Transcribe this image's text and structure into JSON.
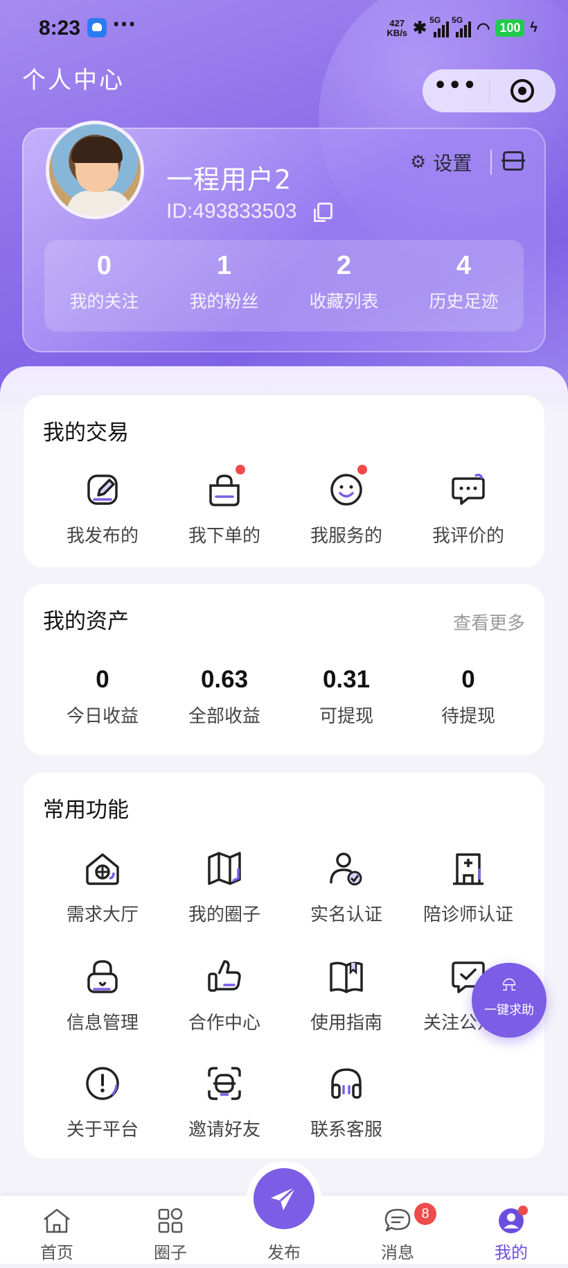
{
  "status_bar": {
    "time": "8:23",
    "dots": "···",
    "net_speed_value": "427",
    "net_speed_unit": "KB/s",
    "sim1": "5G",
    "sim2": "5G",
    "battery": "100"
  },
  "header": {
    "title": "个人中心",
    "capsule_more": "•••"
  },
  "profile": {
    "username": "一程用户2",
    "user_id": "ID:493833503",
    "settings_label": "设置",
    "stats": [
      {
        "value": "0",
        "label": "我的关注"
      },
      {
        "value": "1",
        "label": "我的粉丝"
      },
      {
        "value": "2",
        "label": "收藏列表"
      },
      {
        "value": "4",
        "label": "历史足迹"
      }
    ]
  },
  "transactions": {
    "title": "我的交易",
    "items": [
      {
        "label": "我发布的",
        "icon": "edit-icon",
        "dot": false
      },
      {
        "label": "我下单的",
        "icon": "shopping-bag-icon",
        "dot": true
      },
      {
        "label": "我服务的",
        "icon": "smile-icon",
        "dot": true
      },
      {
        "label": "我评价的",
        "icon": "comment-icon",
        "dot": false
      }
    ]
  },
  "assets": {
    "title": "我的资产",
    "more": "查看更多",
    "items": [
      {
        "value": "0",
        "label": "今日收益"
      },
      {
        "value": "0.63",
        "label": "全部收益"
      },
      {
        "value": "0.31",
        "label": "可提现"
      },
      {
        "value": "0",
        "label": "待提现"
      }
    ]
  },
  "functions": {
    "title": "常用功能",
    "items": [
      {
        "label": "需求大厅",
        "icon": "house-icon"
      },
      {
        "label": "我的圈子",
        "icon": "map-icon"
      },
      {
        "label": "实名认证",
        "icon": "user-verified-icon"
      },
      {
        "label": "陪诊师认证",
        "icon": "hospital-icon"
      },
      {
        "label": "信息管理",
        "icon": "lock-icon"
      },
      {
        "label": "合作中心",
        "icon": "thumbs-up-icon"
      },
      {
        "label": "使用指南",
        "icon": "book-icon"
      },
      {
        "label": "关注公众号",
        "icon": "check-message-icon"
      },
      {
        "label": "关于平台",
        "icon": "alert-circle-icon"
      },
      {
        "label": "邀请好友",
        "icon": "invite-scan-icon"
      },
      {
        "label": "联系客服",
        "icon": "headset-icon"
      }
    ]
  },
  "sos": {
    "label": "一键求助",
    "icon": "alarm-icon"
  },
  "tabbar": {
    "tabs": [
      {
        "label": "首页",
        "icon": "home-icon"
      },
      {
        "label": "圈子",
        "icon": "grid-icon"
      },
      {
        "label": "发布",
        "icon": "paper-plane-icon"
      },
      {
        "label": "消息",
        "icon": "chat-icon"
      },
      {
        "label": "我的",
        "icon": "user-icon"
      }
    ],
    "message_badge": "8",
    "active_color": "#6b4ee0"
  },
  "colors": {
    "accent": "#7b5de6",
    "badge_red": "#ee4b4b"
  }
}
